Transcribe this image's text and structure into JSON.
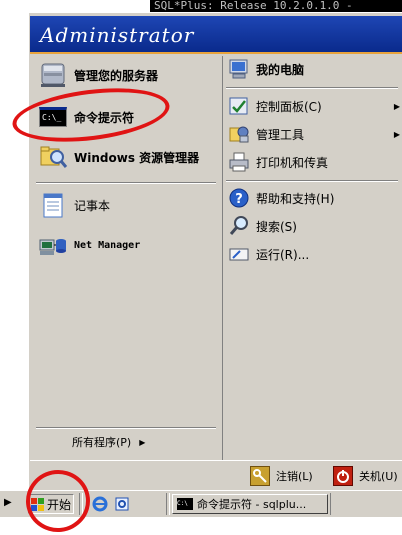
{
  "background_window": {
    "title": "SQL*Plus: Release 10.2.0.1.0 -"
  },
  "start_menu": {
    "user_name": "Administrator",
    "left_items": [
      {
        "label": "管理您的服务器",
        "icon": "server-manage-icon"
      },
      {
        "label": "命令提示符",
        "icon": "command-prompt-icon"
      },
      {
        "label": "Windows 资源管理器",
        "icon": "windows-explorer-icon"
      },
      {
        "label": "记事本",
        "icon": "notepad-icon"
      },
      {
        "label": "Net Manager",
        "icon": "net-manager-icon"
      }
    ],
    "all_programs": "所有程序(P)",
    "right_items": [
      {
        "label": "我的电脑",
        "icon": "my-computer-icon"
      },
      {
        "label": "控制面板(C)",
        "icon": "control-panel-icon",
        "has_submenu": true
      },
      {
        "label": "管理工具",
        "icon": "admin-tools-icon",
        "has_submenu": true
      },
      {
        "label": "打印机和传真",
        "icon": "printer-icon"
      },
      {
        "label": "帮助和支持(H)",
        "icon": "help-icon"
      },
      {
        "label": "搜索(S)",
        "icon": "search-icon"
      },
      {
        "label": "运行(R)...",
        "icon": "run-icon"
      }
    ],
    "logoff": "注销(L)",
    "shutdown": "关机(U)",
    "c_prompt_icon_text": "C:\\_",
    "cmd_small_icon_text": "C:\\"
  },
  "taskbar": {
    "start_label": "开始",
    "quicklaunch": [
      "ie-icon",
      "outlook-icon"
    ],
    "task_label": "命令提示符 - sqlplu..."
  },
  "colors": {
    "header_blue": "#0a2a8c",
    "orange_strip": "#e8a33c",
    "annotation_red": "#e01414",
    "menu_gray": "#d4d0c8"
  }
}
